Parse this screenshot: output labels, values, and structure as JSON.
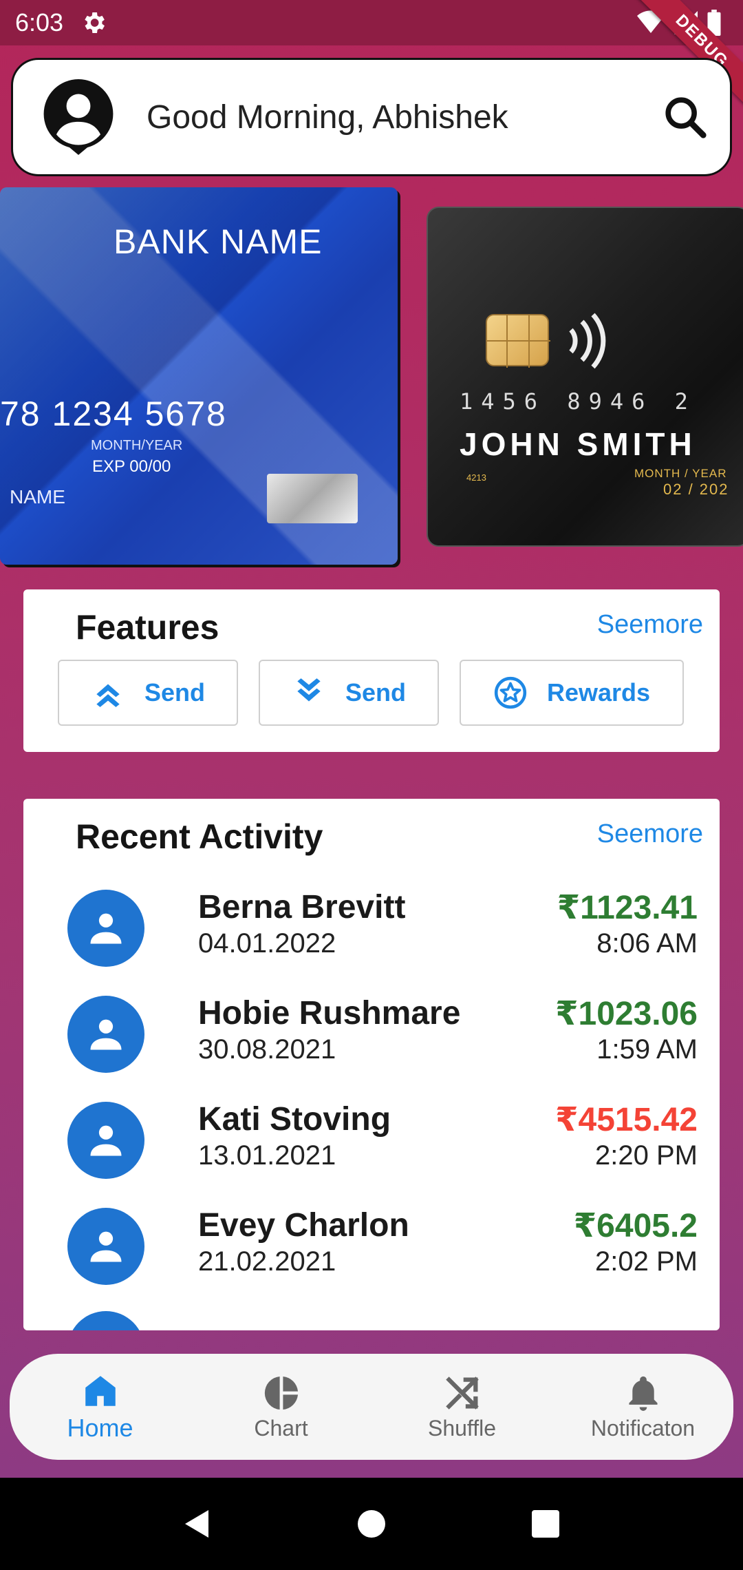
{
  "status_bar": {
    "time": "6:03",
    "icons": [
      "settings-gear-icon",
      "wifi-icon",
      "signal-icon",
      "battery-icon"
    ],
    "debug_label": "DEBUG"
  },
  "header": {
    "greeting": "Good Morning, Abhishek",
    "avatar_icon": "account-circle-icon",
    "search_icon": "search-icon"
  },
  "cards": [
    {
      "bank_name": "BANK NAME",
      "number": "78 1234 5678",
      "exp_label": "MONTH/YEAR",
      "exp": "EXP  00/00",
      "holder": "NAME"
    },
    {
      "number": "1456 8946 2",
      "holder": "JOHN SMITH",
      "small_number": "4213",
      "exp_label": "MONTH / YEAR",
      "exp": "02 / 202"
    }
  ],
  "features": {
    "title": "Features",
    "seemore": "Seemore",
    "buttons": [
      {
        "label": "Send",
        "icon": "double-chevron-up-icon"
      },
      {
        "label": "Send",
        "icon": "double-chevron-down-icon"
      },
      {
        "label": "Rewards",
        "icon": "star-circle-icon"
      }
    ]
  },
  "recent_activity": {
    "title": "Recent Activity",
    "seemore": "Seemore",
    "items": [
      {
        "name": "Berna Brevitt",
        "date": "04.01.2022",
        "amount": "₹1123.41",
        "time": "8:06 AM",
        "color": "#2e7d32"
      },
      {
        "name": "Hobie Rushmare",
        "date": "30.08.2021",
        "amount": "₹1023.06",
        "time": "1:59 AM",
        "color": "#2e7d32"
      },
      {
        "name": "Kati Stoving",
        "date": "13.01.2021",
        "amount": "₹4515.42",
        "time": "2:20 PM",
        "color": "#f44336"
      },
      {
        "name": "Evey Charlon",
        "date": "21.02.2021",
        "amount": "₹6405.2",
        "time": "2:02 PM",
        "color": "#2e7d32"
      }
    ]
  },
  "bottom_nav": {
    "items": [
      {
        "label": "Home",
        "icon": "home-icon",
        "active": true
      },
      {
        "label": "Chart",
        "icon": "pie-chart-icon",
        "active": false
      },
      {
        "label": "Shuffle",
        "icon": "shuffle-icon",
        "active": false
      },
      {
        "label": "Notificaton",
        "icon": "bell-icon",
        "active": false
      }
    ]
  },
  "colors": {
    "accent": "#1e88e5",
    "positive": "#2e7d32",
    "negative": "#f44336",
    "status_bar": "#8e1d44"
  }
}
